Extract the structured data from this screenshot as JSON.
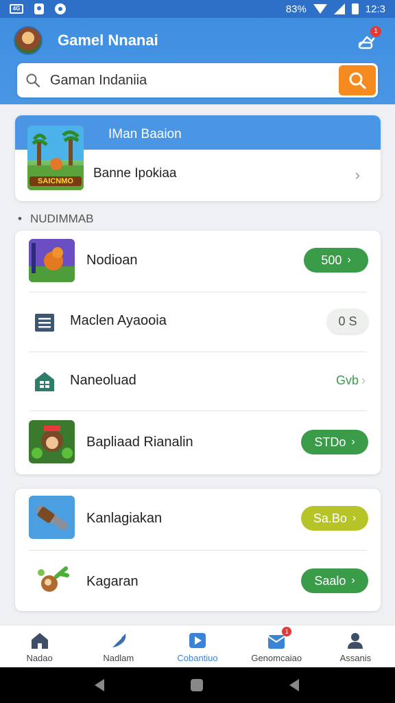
{
  "status_bar": {
    "battery": "83%",
    "time": "12:3"
  },
  "header": {
    "title": "Gamel Nnanai",
    "notification_count": "1",
    "search_value": "Gaman Indaniia"
  },
  "banner": {
    "title": "IMan Baaion",
    "subtitle": "Banne Ipokiaa",
    "thumb_logo": "SAICNMO"
  },
  "section_label": "NUDIMMAB",
  "list1": [
    {
      "label": "Nodioan",
      "value": "500",
      "style": "green"
    },
    {
      "label": "Maclen Ayaooia",
      "value": "0 S",
      "style": "grey"
    },
    {
      "label": "Naneoluad",
      "value": "Gvb",
      "style": "plain"
    },
    {
      "label": "Bapliaad Rianalin",
      "value": "STDo",
      "style": "green"
    }
  ],
  "list2": [
    {
      "label": "Kanlagiakan",
      "value": "Sa.Bo",
      "style": "lime"
    },
    {
      "label": "Kagaran",
      "value": "Saalo",
      "style": "green"
    }
  ],
  "bottom_nav": [
    {
      "label": "Nadao",
      "icon": "home-icon"
    },
    {
      "label": "Nadlam",
      "icon": "feather-icon"
    },
    {
      "label": "Cobantiuo",
      "icon": "play-icon",
      "active": true
    },
    {
      "label": "Genomcaiao",
      "icon": "inbox-icon",
      "badge": "1"
    },
    {
      "label": "Assanis",
      "icon": "person-icon"
    }
  ],
  "colors": {
    "header_blue": "#4a96e4",
    "accent_orange": "#f58a1f",
    "green": "#3a9b48",
    "lime": "#b7c428"
  }
}
